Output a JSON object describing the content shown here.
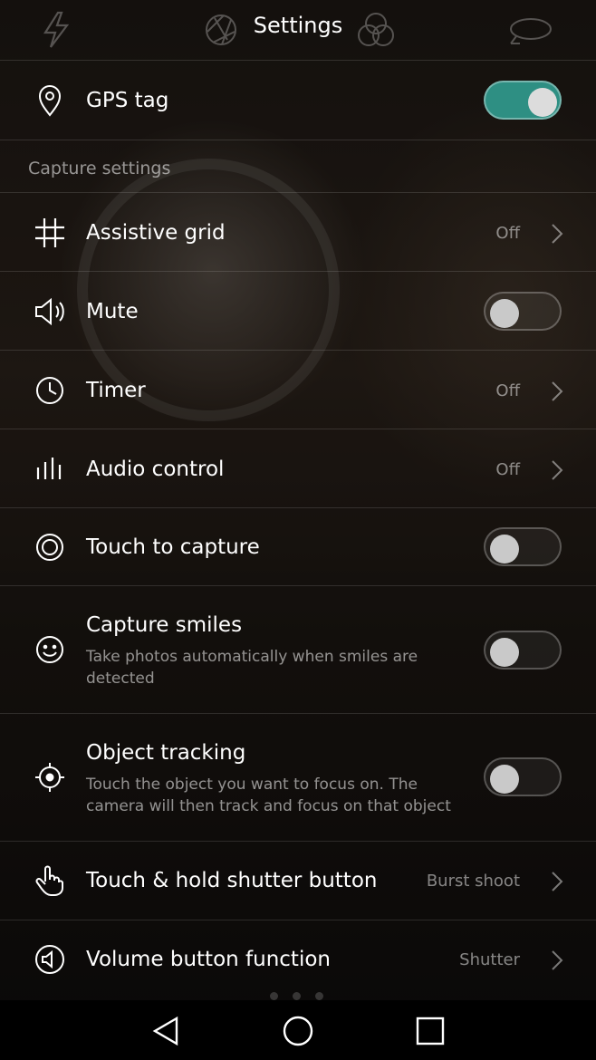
{
  "header": {
    "title": "Settings"
  },
  "rows": [
    {
      "id": "gps",
      "label": "GPS tag",
      "icon": "location-pin-icon",
      "control": "toggle",
      "on": true
    },
    {
      "id": "grid",
      "label": "Assistive grid",
      "icon": "grid-icon",
      "control": "value",
      "value": "Off"
    },
    {
      "id": "mute",
      "label": "Mute",
      "icon": "speaker-icon",
      "control": "toggle",
      "on": false
    },
    {
      "id": "timer",
      "label": "Timer",
      "icon": "clock-icon",
      "control": "value",
      "value": "Off"
    },
    {
      "id": "audio",
      "label": "Audio control",
      "icon": "audio-bars-icon",
      "control": "value",
      "value": "Off"
    },
    {
      "id": "touch",
      "label": "Touch to capture",
      "icon": "touch-target-icon",
      "control": "toggle",
      "on": false
    },
    {
      "id": "smiles",
      "label": "Capture smiles",
      "desc": "Take photos automatically when smiles are detected",
      "icon": "smile-icon",
      "control": "toggle",
      "on": false
    },
    {
      "id": "tracking",
      "label": "Object tracking",
      "desc": "Touch the object you want to focus on. The camera will then track and focus on that object",
      "icon": "crosshair-icon",
      "control": "toggle",
      "on": false
    },
    {
      "id": "hold",
      "label": "Touch & hold shutter button",
      "icon": "hand-tap-icon",
      "control": "value",
      "value": "Burst shoot"
    },
    {
      "id": "volume",
      "label": "Volume button function",
      "icon": "volume-circle-icon",
      "control": "value",
      "value": "Shutter"
    }
  ],
  "section": {
    "capture_settings": "Capture settings"
  },
  "colors": {
    "toggle_on": "#2e8f83",
    "toggle_off_knob": "#c9c9c9",
    "divider": "rgba(255,255,255,0.13)"
  },
  "navbar": {
    "back": "back-icon",
    "home": "home-icon",
    "recents": "recents-icon"
  }
}
